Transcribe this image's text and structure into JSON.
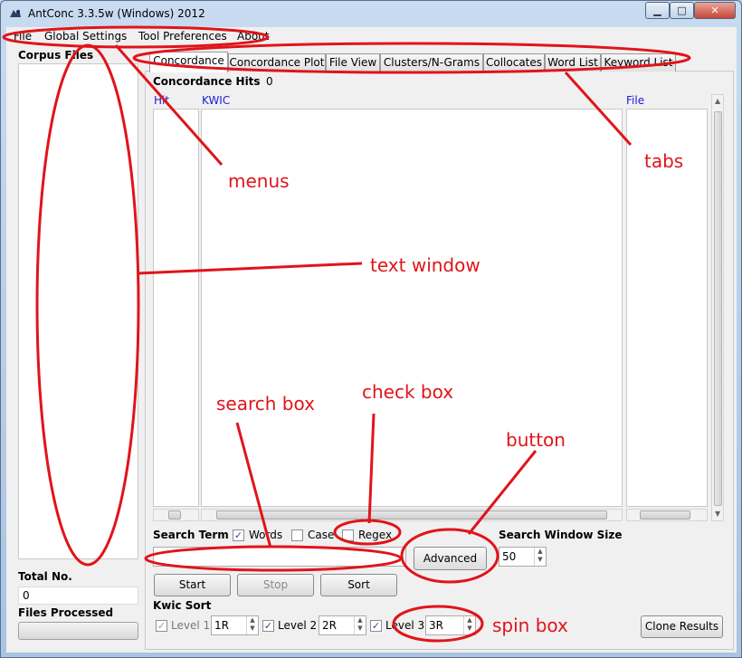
{
  "window": {
    "title": "AntConc 3.3.5w (Windows) 2012"
  },
  "window_buttons": {
    "minimize": "▁",
    "maximize": "□",
    "close": "✕"
  },
  "menu": [
    "File",
    "Global Settings",
    "Tool Preferences",
    "About"
  ],
  "corpus": {
    "label": "Corpus Files",
    "total_label": "Total No.",
    "total_value": "0",
    "processed_label": "Files Processed",
    "progress": 0
  },
  "tabs": [
    "Concordance",
    "Concordance Plot",
    "File View",
    "Clusters/N-Grams",
    "Collocates",
    "Word List",
    "Keyword List"
  ],
  "active_tab": "Concordance",
  "concordance": {
    "hits_label": "Concordance Hits",
    "hits_value": "0",
    "col_hit": "Hit",
    "col_kwic": "KWIC",
    "col_file": "File"
  },
  "search": {
    "term_label": "Search Term",
    "words": {
      "label": "Words",
      "checked": true
    },
    "case": {
      "label": "Case",
      "checked": false
    },
    "regex": {
      "label": "Regex",
      "checked": false
    },
    "input_value": "",
    "advanced_label": "Advanced",
    "window_size_label": "Search Window Size",
    "window_size_value": "50"
  },
  "actions": {
    "start": "Start",
    "stop": "Stop",
    "sort": "Sort"
  },
  "kwic_sort": {
    "label": "Kwic Sort",
    "level1_label": "Level 1",
    "level1_value": "1R",
    "level1_checked": true,
    "level2_label": "Level 2",
    "level2_value": "2R",
    "level2_checked": true,
    "level3_label": "Level 3",
    "level3_value": "3R",
    "level3_checked": true
  },
  "clone_results": "Clone Results",
  "annotations": {
    "menus": "menus",
    "tabs": "tabs",
    "text_window": "text window",
    "search_box": "search box",
    "check_box": "check box",
    "button": "button",
    "spin_box": "spin box",
    "color": "#e0141a"
  }
}
